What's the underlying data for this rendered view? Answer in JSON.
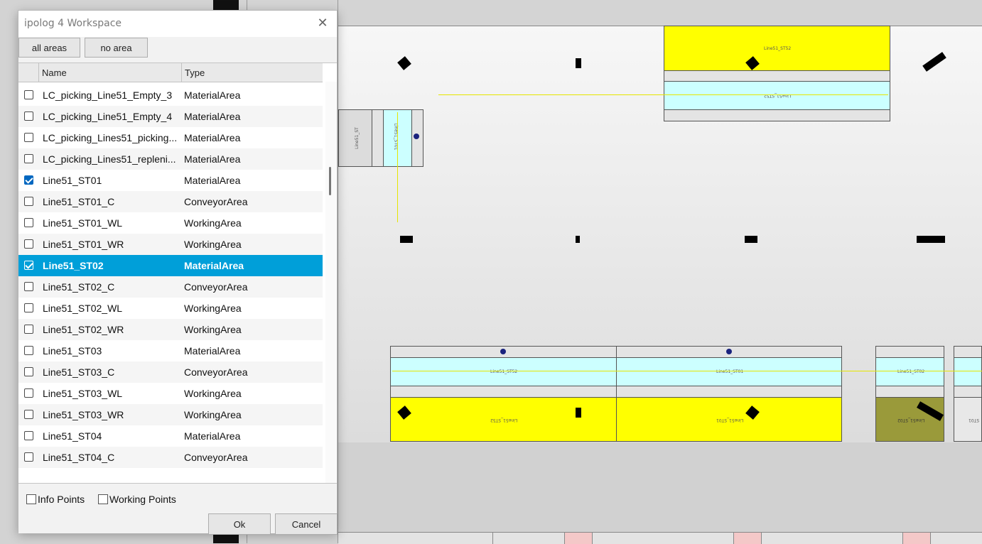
{
  "dialog": {
    "title": "ipolog 4 Workspace",
    "close_glyph": "✕",
    "buttons": {
      "all_areas": "all areas",
      "no_area": "no area"
    },
    "columns": {
      "name": "Name",
      "type": "Type"
    },
    "rows": [
      {
        "name": "LC_picking_Line51_Empty_3",
        "type": "MaterialArea",
        "checked": false
      },
      {
        "name": "LC_picking_Line51_Empty_4",
        "type": "MaterialArea",
        "checked": false
      },
      {
        "name": "LC_picking_Lines51_picking...",
        "type": "MaterialArea",
        "checked": false
      },
      {
        "name": "LC_picking_Lines51_repleni...",
        "type": "MaterialArea",
        "checked": false
      },
      {
        "name": "Line51_ST01",
        "type": "MaterialArea",
        "checked": true
      },
      {
        "name": "Line51_ST01_C",
        "type": "ConveyorArea",
        "checked": false
      },
      {
        "name": "Line51_ST01_WL",
        "type": "WorkingArea",
        "checked": false
      },
      {
        "name": "Line51_ST01_WR",
        "type": "WorkingArea",
        "checked": false
      },
      {
        "name": "Line51_ST02",
        "type": "MaterialArea",
        "checked": true,
        "selected": true
      },
      {
        "name": "Line51_ST02_C",
        "type": "ConveyorArea",
        "checked": false
      },
      {
        "name": "Line51_ST02_WL",
        "type": "WorkingArea",
        "checked": false
      },
      {
        "name": "Line51_ST02_WR",
        "type": "WorkingArea",
        "checked": false
      },
      {
        "name": "Line51_ST03",
        "type": "MaterialArea",
        "checked": false
      },
      {
        "name": "Line51_ST03_C",
        "type": "ConveyorArea",
        "checked": false
      },
      {
        "name": "Line51_ST03_WL",
        "type": "WorkingArea",
        "checked": false
      },
      {
        "name": "Line51_ST03_WR",
        "type": "WorkingArea",
        "checked": false
      },
      {
        "name": "Line51_ST04",
        "type": "MaterialArea",
        "checked": false
      },
      {
        "name": "Line51_ST04_C",
        "type": "ConveyorArea",
        "checked": false
      }
    ],
    "options": {
      "info_points": "Info Points",
      "working_points": "Working Points"
    },
    "actions": {
      "ok": "Ok",
      "cancel": "Cancel"
    }
  },
  "canvas": {
    "labels": {
      "top_yellow": "Line51_ST52",
      "top_cyan": "Line51_ST52",
      "bottom_cyan_1": "Line51_ST52",
      "bottom_cyan_2": "Line51_ST01",
      "bottom_cyan_3": "Line51_ST02",
      "bottom_yellow_1": "Line51_ST52",
      "bottom_yellow_2": "Line51_ST01",
      "bottom_olive": "Line51_ST02",
      "left_grey": "Line51_ST",
      "left_cyan": "Line51_ST01",
      "right_partial": "ST01"
    },
    "colors": {
      "material": "#ffff00",
      "conveyor": "#ccffff",
      "selected_row": "#009fd9",
      "flow": "#e6e600",
      "olive": "#9a9a3a"
    }
  }
}
